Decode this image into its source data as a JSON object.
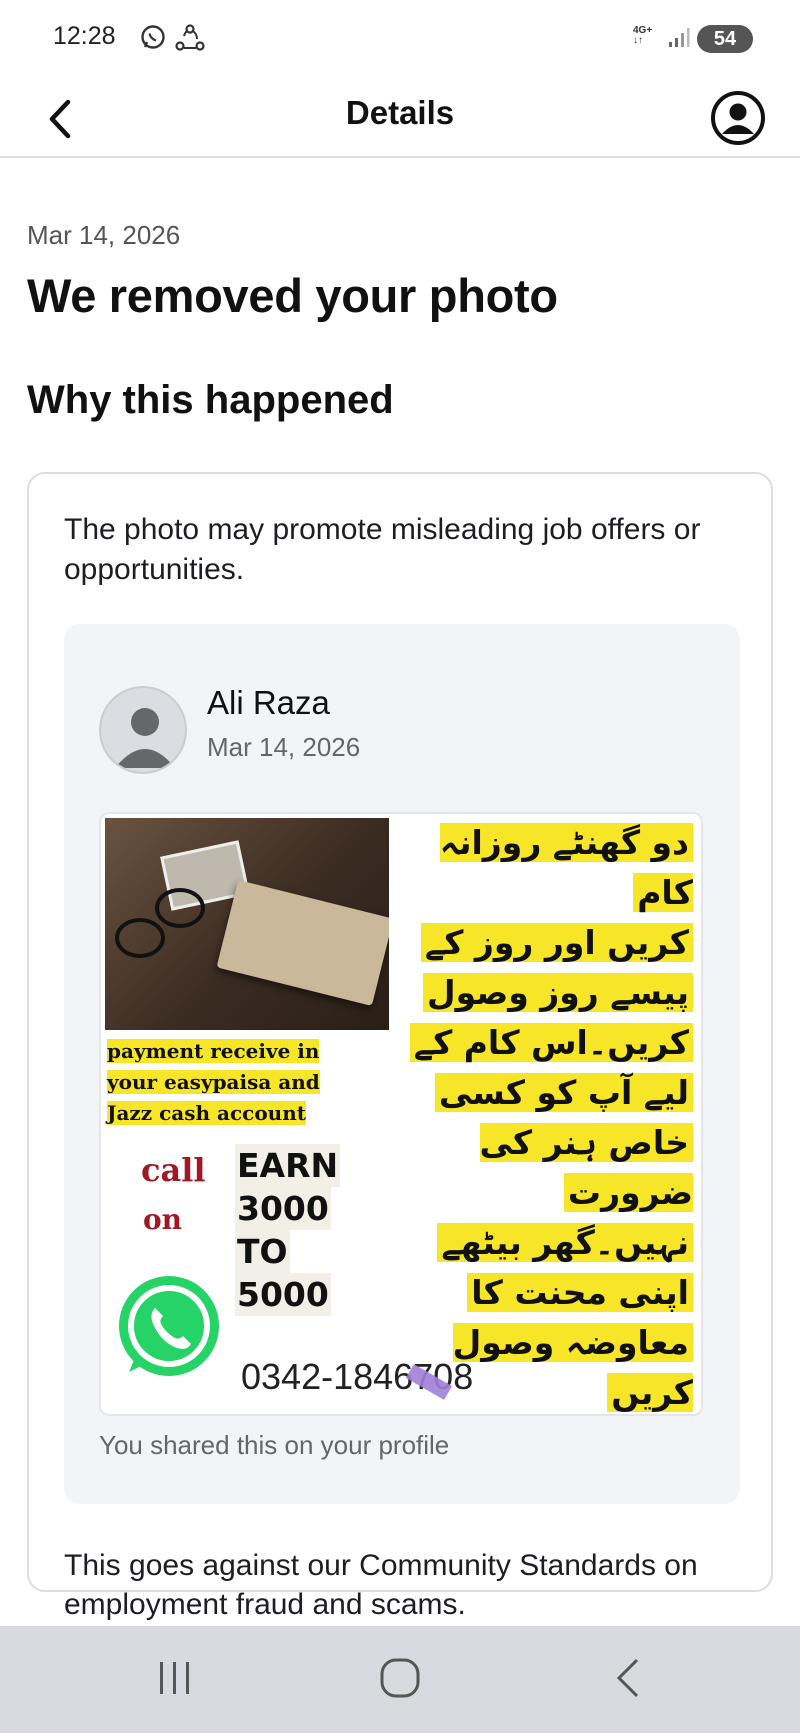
{
  "status_bar": {
    "time": "12:28",
    "network": "4G+",
    "battery": "54"
  },
  "header": {
    "title": "Details"
  },
  "notice": {
    "date": "Mar 14, 2026",
    "title": "We removed your photo",
    "section_heading": "Why this happened",
    "reason": "The photo may promote misleading job offers or opportunities.",
    "standards_note": "This goes against our Community Standards on employment fraud and scams."
  },
  "post": {
    "author": "Ali Raza",
    "date": "Mar 14, 2026",
    "shared_note": "You shared this on your profile",
    "image": {
      "urdu_lines": [
        "دو گھنٹے روزانہ کام",
        "کریں اور روز کے",
        "پیسے روز وصول",
        "کریں۔اس کام کے",
        "لیے آپ کو کسی",
        "خاص ہنر کی ضرورت",
        "نہیں۔گھر بیٹھے",
        "اپنی محنت کا",
        "معاوضہ وصول کریں"
      ],
      "payment_lines": [
        "payment receive in",
        "your easypaisa and",
        "Jazz cash account"
      ],
      "call_text": "call",
      "on_text": "on",
      "earn_lines": [
        "EARN",
        "3000",
        "TO",
        "5000"
      ],
      "phone_number": "0342-1846708"
    }
  },
  "icons": {
    "back": "chevron-left-icon",
    "profile": "account-circle-icon",
    "whatsapp": "whatsapp-icon"
  },
  "colors": {
    "highlight_yellow": "#f7e628",
    "call_red": "#a01822",
    "whatsapp_green": "#25d366",
    "nav_bar_bg": "#d9dadf"
  }
}
